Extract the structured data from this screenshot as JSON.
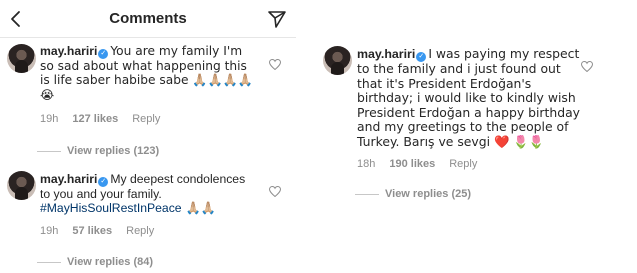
{
  "header": {
    "title": "Comments",
    "back_icon": "chevron-left-icon",
    "send_icon": "paper-plane-icon"
  },
  "left_comments": [
    {
      "username": "may.hariri",
      "text": "You are my family I'm so sad about what happening  this is life saber habibe sabe 🙏🏼🙏🏼🙏🏼🙏🏼 😭",
      "time": "19h",
      "likes": "127 likes",
      "reply": "Reply",
      "view_replies": "View replies (123)"
    },
    {
      "username": "may.hariri",
      "text_before": "My deepest condolences to you and your family. ",
      "hashtag": "#MayHisSoulRestInPeace",
      "text_after": " 🙏🏼🙏🏼",
      "time": "19h",
      "likes": "57 likes",
      "reply": "Reply",
      "view_replies": "View replies (84)"
    }
  ],
  "right_comment": {
    "username": "may.hariri",
    "text": "I was paying my respect to the family and i just found out that it's President Erdoğan's birthday; i would like to kindly wish President Erdoğan a happy birthday and my greetings to the people of Turkey. Barış ve sevgi ❤️ 🌷🌷",
    "time": "18h",
    "likes": "190 likes",
    "reply": "Reply",
    "view_replies": "View replies (25)"
  },
  "colors": {
    "text": "#262626",
    "meta": "#8e8e8e",
    "verified": "#3897f0",
    "hashtag": "#003569"
  }
}
